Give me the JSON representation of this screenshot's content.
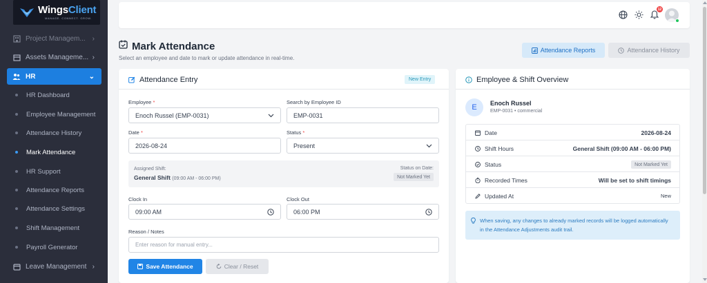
{
  "brand": {
    "name_part1": "Wings",
    "name_part2": "Client",
    "tagline": "MANAGE. CONNECT. GROW."
  },
  "sidebar": {
    "items": [
      {
        "label": "Project Managem...",
        "icon": "building-icon"
      },
      {
        "label": "Assets Manageme...",
        "icon": "box-icon"
      },
      {
        "label": "HR",
        "icon": "people-icon"
      },
      {
        "label": "Leave Management",
        "icon": "calendar-icon"
      }
    ],
    "hr_submenu": [
      "HR Dashboard",
      "Employee Management",
      "Attendance History",
      "Mark Attendance",
      "HR Support",
      "Attendance Reports",
      "Attendance Settings",
      "Shift Management",
      "Payroll Generator"
    ]
  },
  "topbar": {
    "notification_count": "12"
  },
  "page": {
    "title": "Mark Attendance",
    "subtitle": "Select an employee and date to mark or update attendance in real-time.",
    "reports_button": "Attendance Reports",
    "history_button": "Attendance History"
  },
  "entry": {
    "title": "Attendance Entry",
    "badge": "New Entry",
    "employee_label": "Employee",
    "employee_value": "Enoch Russel (EMP-0031)",
    "search_label": "Search by Employee ID",
    "search_value": "EMP-0031",
    "date_label": "Date",
    "date_value": "2026-08-24",
    "status_label": "Status",
    "status_value": "Present",
    "assigned_label": "Assigned Shift:",
    "assigned_shift": "General Shift",
    "assigned_hours": "(09:00 AM - 06:00 PM)",
    "status_on_date_label": "Status on Date:",
    "status_on_date_value": "Not Marked Yet",
    "clock_in_label": "Clock In",
    "clock_in_value": "09:00 AM",
    "clock_out_label": "Clock Out",
    "clock_out_value": "06:00 PM",
    "notes_label": "Reason / Notes",
    "notes_placeholder": "Enter reason for manual entry...",
    "save_button": "Save Attendance",
    "clear_button": "Clear / Reset"
  },
  "overview": {
    "title": "Employee & Shift Overview",
    "avatar_initial": "E",
    "name": "Enoch Russel",
    "meta": "EMP-0031 • commercial",
    "rows": [
      {
        "key": "Date",
        "value": "2026-08-24",
        "icon": "calendar-icon"
      },
      {
        "key": "Shift Hours",
        "value": "General Shift (09:00 AM - 06:00 PM)",
        "icon": "clock-icon"
      },
      {
        "key": "Status",
        "value": "Not Marked Yet",
        "icon": "check-circle-icon"
      },
      {
        "key": "Recorded Times",
        "value": "Will be set to shift timings",
        "icon": "stopwatch-icon"
      },
      {
        "key": "Updated At",
        "value": "New",
        "icon": "pencil-icon"
      }
    ],
    "note": "When saving, any changes to already marked records will be logged automatically in the Attendance Adjustments audit trail."
  }
}
